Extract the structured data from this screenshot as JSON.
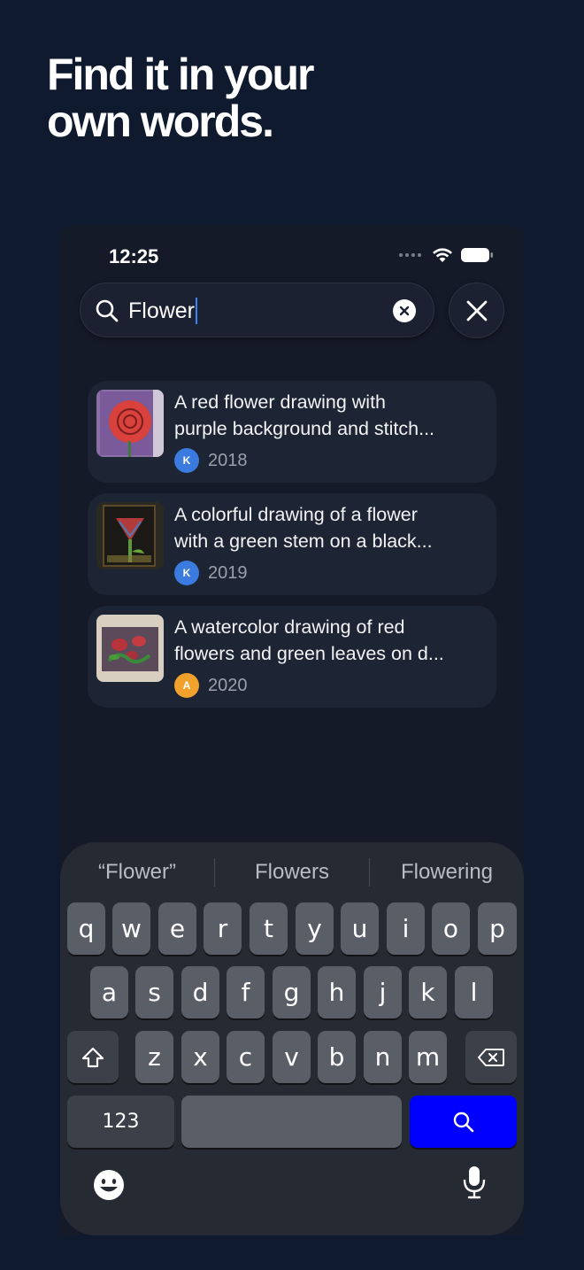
{
  "headline": {
    "line1": "Find it in your",
    "line2": "own words."
  },
  "status": {
    "time": "12:25"
  },
  "search": {
    "query": "Flower"
  },
  "results": [
    {
      "title_line1": "A red flower drawing with",
      "title_line2": "purple background and stitch...",
      "avatar": "K",
      "avatar_color": "#3b7be0",
      "year": "2018"
    },
    {
      "title_line1": "A colorful drawing of a flower",
      "title_line2": "with a green stem on a black...",
      "avatar": "K",
      "avatar_color": "#3b7be0",
      "year": "2019"
    },
    {
      "title_line1": "A watercolor drawing of red",
      "title_line2": "flowers and green leaves on d...",
      "avatar": "A",
      "avatar_color": "#f2a22c",
      "year": "2020"
    }
  ],
  "keyboard": {
    "suggestions": [
      "“Flower”",
      "Flowers",
      "Flowering"
    ],
    "row1": [
      "q",
      "w",
      "e",
      "r",
      "t",
      "y",
      "u",
      "i",
      "o",
      "p"
    ],
    "row2": [
      "a",
      "s",
      "d",
      "f",
      "g",
      "h",
      "j",
      "k",
      "l"
    ],
    "row3": [
      "z",
      "x",
      "c",
      "v",
      "b",
      "n",
      "m"
    ],
    "numbers_label": "123"
  },
  "colors": {
    "background": "#0f1a2f",
    "search_key": "#0000ff"
  }
}
